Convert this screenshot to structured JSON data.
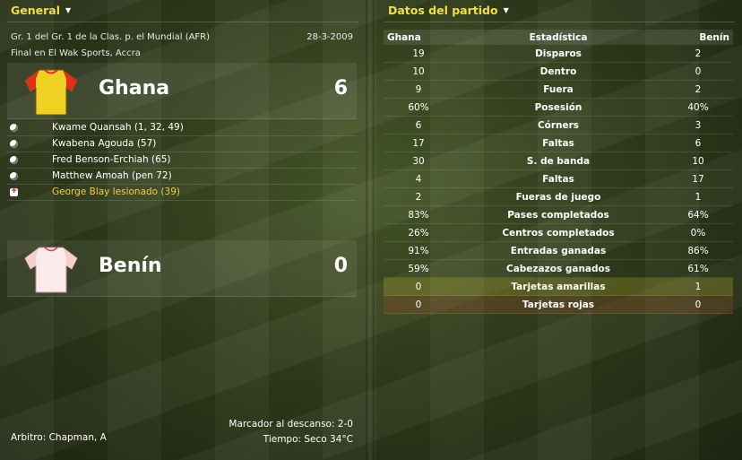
{
  "general": {
    "header": "General",
    "competition": "Gr. 1 del Gr. 1 de la Clas. p. el Mundial (AFR)",
    "date": "28-3-2009",
    "venue": "Final en El Wak Sports, Accra",
    "home": {
      "name": "Ghana",
      "score": "6",
      "shirt_colors": {
        "body": "#f0d020",
        "sleeves": "#e03018"
      }
    },
    "away": {
      "name": "Benín",
      "score": "0",
      "shirt_colors": {
        "body": "#fbeaea",
        "sleeves": "#f6d0d0"
      }
    },
    "events": [
      {
        "icon": "goal-ball-icon",
        "text": "Kwame Quansah (1, 32, 49)",
        "highlight": false
      },
      {
        "icon": "goal-ball-icon",
        "text": "Kwabena Agouda (57)",
        "highlight": false
      },
      {
        "icon": "goal-ball-icon",
        "text": "Fred Benson-Erchiah (65)",
        "highlight": false
      },
      {
        "icon": "goal-ball-icon",
        "text": "Matthew Amoah (pen 72)",
        "highlight": false
      },
      {
        "icon": "injury-cross-icon",
        "text": "George Blay lesionado (39)",
        "highlight": true
      }
    ],
    "halftime": "Marcador al descanso: 2-0",
    "weather": "Tiempo: Seco 34°C",
    "referee": "Arbitro: Chapman, A"
  },
  "match_data": {
    "header": "Datos del partido",
    "columns": {
      "home": "Ghana",
      "stat": "Estadística",
      "away": "Benín"
    },
    "rows": [
      {
        "home": "19",
        "stat": "Disparos",
        "away": "2"
      },
      {
        "home": "10",
        "stat": "Dentro",
        "away": "0"
      },
      {
        "home": "9",
        "stat": "Fuera",
        "away": "2"
      },
      {
        "home": "60%",
        "stat": "Posesión",
        "away": "40%"
      },
      {
        "home": "6",
        "stat": "Córners",
        "away": "3"
      },
      {
        "home": "17",
        "stat": "Faltas",
        "away": "6"
      },
      {
        "home": "30",
        "stat": "S. de banda",
        "away": "10"
      },
      {
        "home": "4",
        "stat": "Faltas",
        "away": "17"
      },
      {
        "home": "2",
        "stat": "Fueras de juego",
        "away": "1"
      },
      {
        "home": "83%",
        "stat": "Pases completados",
        "away": "64%"
      },
      {
        "home": "26%",
        "stat": "Centros completados",
        "away": "0%"
      },
      {
        "home": "91%",
        "stat": "Entradas ganadas",
        "away": "86%"
      },
      {
        "home": "59%",
        "stat": "Cabezazos ganados",
        "away": "61%"
      },
      {
        "home": "0",
        "stat": "Tarjetas amarillas",
        "away": "1"
      },
      {
        "home": "0",
        "stat": "Tarjetas rojas",
        "away": "0"
      }
    ]
  },
  "colors": {
    "accent": "#f0e040",
    "highlight_text": "#f0d040"
  }
}
